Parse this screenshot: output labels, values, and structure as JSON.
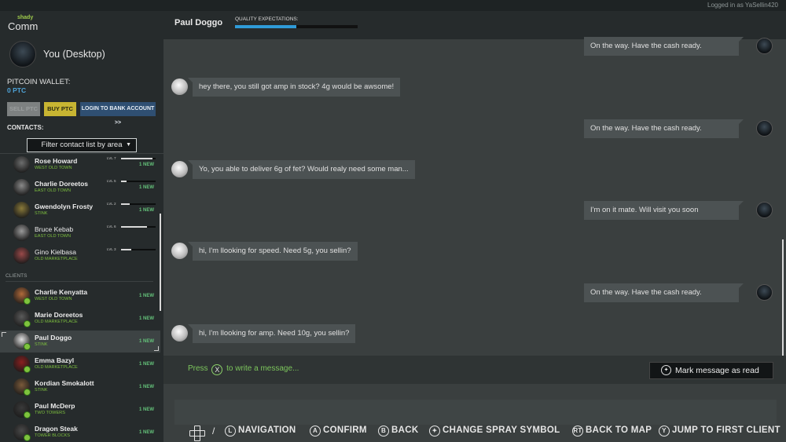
{
  "topbar": {
    "login_text": "Logged in as YaSellin420"
  },
  "logo": {
    "small": "shady",
    "big": "Comm"
  },
  "profile": {
    "name": "You (Desktop)"
  },
  "wallet": {
    "label": "PITCOIN WALLET:",
    "value": "0 PTC"
  },
  "buttons": {
    "sell": "SELL PTC",
    "buy": "BUY PTC",
    "bank": "LOGIN TO BANK ACCOUNT >>"
  },
  "contacts": {
    "label": "CONTACTS:",
    "filter": "Filter contact list by area",
    "dealers": [
      {
        "name": "Rose Howard",
        "area": "WEST OLD TOWN",
        "lvl": "LVL 7",
        "level": 0.9,
        "new": "1 NEW",
        "avatar": "#6d6e6e"
      },
      {
        "name": "Charlie Doreetos",
        "area": "EAST OLD TOWN",
        "lvl": "LVL 5",
        "level": 0.15,
        "new": "1 NEW",
        "avatar": "#8a8a8a"
      },
      {
        "name": "Gwendolyn Frosty",
        "area": "STINK",
        "lvl": "LVL 2",
        "level": 0.25,
        "new": "1 NEW",
        "avatar": "#8a7a3a"
      },
      {
        "name": "Bruce Kebab",
        "area": "EAST OLD TOWN",
        "lvl": "LVL 6",
        "level": 0.75,
        "new": "",
        "avatar": "#9a9a9a"
      },
      {
        "name": "Gino Kielbasa",
        "area": "OLD MARKETPLACE",
        "lvl": "LVL 3",
        "level": 0.3,
        "new": "",
        "avatar": "#9a4a4a"
      }
    ],
    "clients_label": "CLIENTS",
    "clients": [
      {
        "name": "Charlie Kenyatta",
        "area": "WEST OLD TOWN",
        "new": "1 NEW",
        "avatar": "#b06a3a"
      },
      {
        "name": "Marie Doreetos",
        "area": "OLD MARKETPLACE",
        "new": "1 NEW",
        "avatar": "#5a5a5a"
      },
      {
        "name": "Paul Doggo",
        "area": "STINK",
        "new": "1 NEW",
        "avatar": "#e0e0e0"
      },
      {
        "name": "Emma Bazyl",
        "area": "OLD MARKETPLACE",
        "new": "1 NEW",
        "avatar": "#8a2020"
      },
      {
        "name": "Kordian Smokalott",
        "area": "STINK",
        "new": "1 NEW",
        "avatar": "#7a5a3a"
      },
      {
        "name": "Paul McDerp",
        "area": "TWO TOWERS",
        "new": "1 NEW",
        "avatar": "#3a3a3a"
      },
      {
        "name": "Dragon Steak",
        "area": "TOWER BLOCKS",
        "new": "1 NEW",
        "avatar": "#4a4a4a"
      }
    ]
  },
  "chat": {
    "contact_name": "Paul Doggo",
    "quality_label": "QUALITY EXPECTATIONS:",
    "quality_level": 0.5,
    "messages": [
      {
        "from": "me",
        "text": "On the way. Have the cash ready."
      },
      {
        "from": "them",
        "text": "hey there, you still got amp in stock? 4g would be awsome!"
      },
      {
        "from": "me",
        "text": "On the way. Have the cash ready."
      },
      {
        "from": "them",
        "text": "Yo, you able to deliver 6g of fet? Would realy need some man..."
      },
      {
        "from": "me",
        "text": "I'm on it mate. Will visit you soon"
      },
      {
        "from": "them",
        "text": "hi, I'm llooking for speed. Need 5g, you sellin?"
      },
      {
        "from": "me",
        "text": "On the way. Have the cash ready."
      },
      {
        "from": "them",
        "text": "hi, I'm llooking for amp. Need 10g, you sellin?"
      }
    ],
    "compose": {
      "press": "Press",
      "key": "X",
      "rest": "to write a message..."
    },
    "mark_read": "Mark message as read"
  },
  "footer": {
    "slash": "/",
    "items": [
      {
        "key": "L",
        "label": "NAVIGATION"
      },
      {
        "key": "A",
        "label": "CONFIRM"
      },
      {
        "key": "B",
        "label": "BACK"
      },
      {
        "key": "✦",
        "label": "CHANGE SPRAY SYMBOL"
      },
      {
        "key": "RT",
        "label": "BACK TO MAP"
      },
      {
        "key": "Y",
        "label": "JUMP TO FIRST CLIENT"
      }
    ]
  }
}
